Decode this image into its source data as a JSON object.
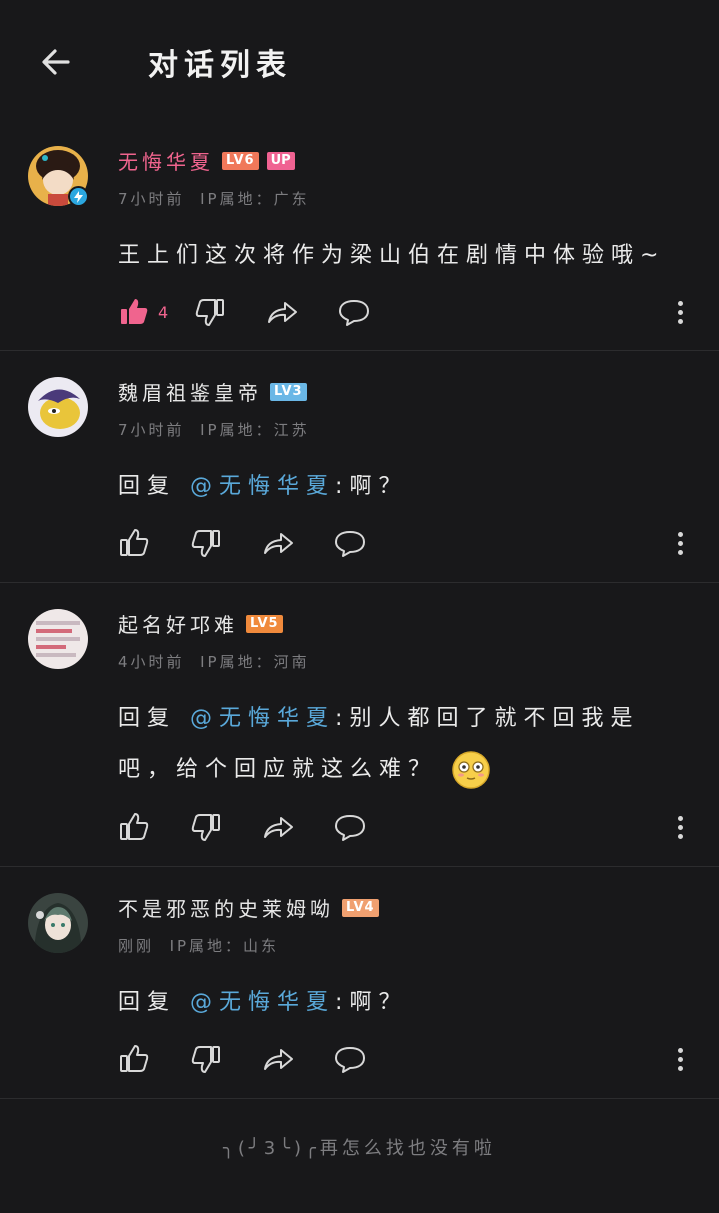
{
  "header": {
    "title": "对话列表"
  },
  "comments": [
    {
      "username": "无悔华夏",
      "level": "LV6",
      "level_color": "#f0785a",
      "up_tag": "UP",
      "time": "7小时前",
      "ip": "IP属地：广东",
      "text": "王上们这次将作为梁山伯在剧情中体验哦~",
      "likes": "4"
    },
    {
      "username": "魏眉祖鉴皇帝",
      "level": "LV3",
      "level_color": "#6ab7e6",
      "time": "7小时前",
      "ip": "IP属地：江苏",
      "reply_prefix": "回复",
      "mention": "@无悔华夏",
      "text": ":啊？"
    },
    {
      "username": "起名好邛难",
      "level": "LV5",
      "level_color": "#f08a3c",
      "time": "4小时前",
      "ip": "IP属地：河南",
      "reply_prefix": "回复",
      "mention": "@无悔华夏",
      "text": ":别人都回了就不回我是吧，给个回应就这么难？"
    },
    {
      "username": "不是邪恶的史莱姆呦",
      "level": "LV4",
      "level_color": "#f0a070",
      "time": "刚刚",
      "ip": "IP属地：山东",
      "reply_prefix": "回复",
      "mention": "@无悔华夏",
      "text": ":啊？"
    }
  ],
  "footer": {
    "text": "╮(╯3╰)╭再怎么找也没有啦"
  }
}
